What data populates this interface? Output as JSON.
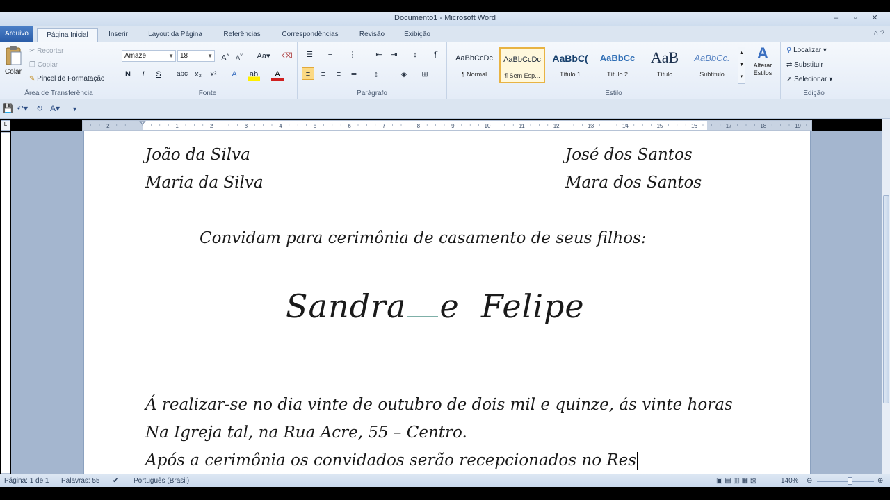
{
  "window": {
    "title": "Documento1 - Microsoft Word",
    "controls": [
      "–",
      "▫",
      "✕"
    ]
  },
  "tabs": [
    "Arquivo",
    "Página Inicial",
    "Inserir",
    "Layout da Página",
    "Referências",
    "Correspondências",
    "Revisão",
    "Exibição"
  ],
  "ribbon": {
    "clipboard": {
      "paste_label": "Colar",
      "cut": "Recortar",
      "copy": "Copiar",
      "format_painter": "Pincel de Formatação",
      "group_label": "Área de Transferência"
    },
    "font": {
      "font_name": "Amaze",
      "font_size": "18",
      "group_label": "Fonte",
      "buttons": {
        "bold": "N",
        "italic": "I",
        "underline": "S",
        "strike": "abc",
        "sub": "x₂",
        "sup": "x²"
      }
    },
    "paragraph": {
      "group_label": "Parágrafo"
    },
    "styles": {
      "group_label": "Estilo",
      "items": [
        {
          "sample": "AaBbCcDc",
          "name": "¶ Normal"
        },
        {
          "sample": "AaBbCcDc",
          "name": "¶ Sem Esp..."
        },
        {
          "sample": "AaBbC(",
          "name": "Título 1"
        },
        {
          "sample": "AaBbCc",
          "name": "Título 2"
        },
        {
          "sample": "AaB",
          "name": "Título"
        },
        {
          "sample": "AaBbCc.",
          "name": "Subtítulo"
        }
      ],
      "change_styles": "Alterar Estilos"
    },
    "editing": {
      "find": "Localizar",
      "replace": "Substituir",
      "select": "Selecionar",
      "group_label": "Edição"
    }
  },
  "ruler_numbers": [
    "1",
    "2",
    "1",
    "2",
    "3",
    "4",
    "5",
    "6",
    "7",
    "8",
    "9",
    "10",
    "11",
    "12",
    "13",
    "14",
    "15",
    "16",
    "17",
    "18",
    "19"
  ],
  "document": {
    "left_names": [
      "João da Silva",
      "Maria da Silva"
    ],
    "right_names": [
      "José dos Santos",
      "Mara dos Santos"
    ],
    "invite_line": "Convidam para cerimônia de casamento de seus filhos:",
    "couple_1": "Sandra",
    "couple_and": "e",
    "couple_2": "Felipe",
    "body_lines": [
      "Á realizar-se no dia vinte de outubro de dois mil e quinze, ás vinte horas",
      "Na Igreja tal, na Rua Acre, 55 – Centro.",
      "Após a cerimônia os convidados serão recepcionados no Res"
    ]
  },
  "status": {
    "page": "Página: 1 de 1",
    "words": "Palavras: 55",
    "language": "Português (Brasil)",
    "zoom": "140%"
  }
}
